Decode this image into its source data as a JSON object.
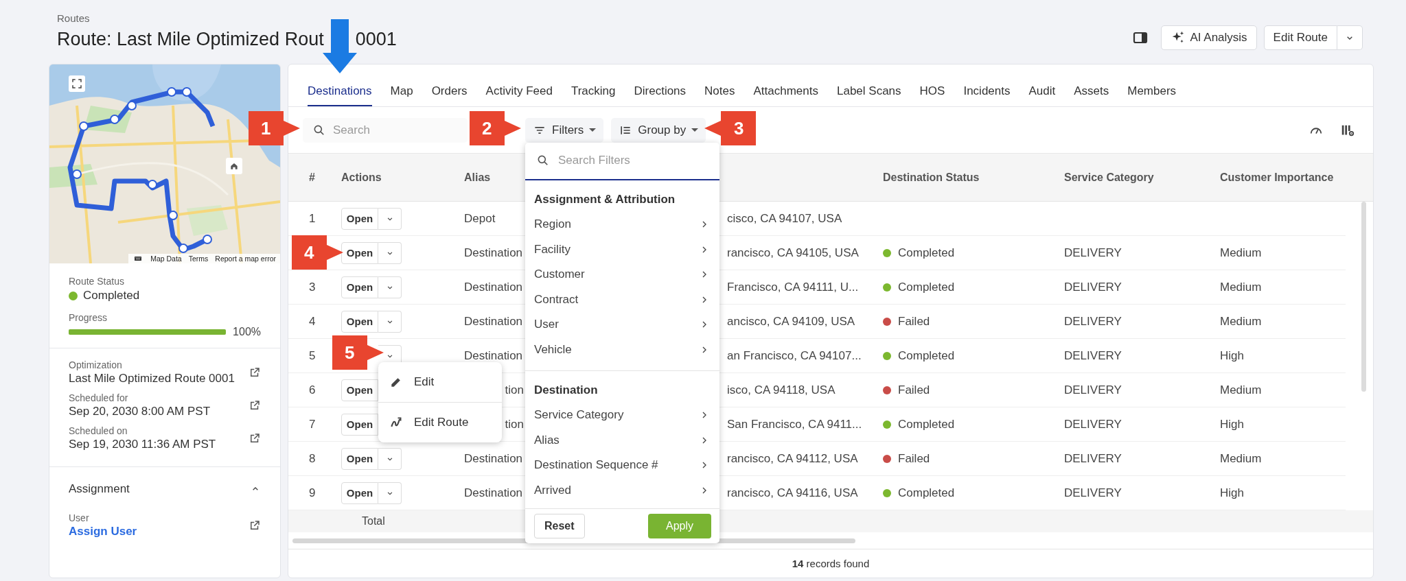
{
  "breadcrumb": "Routes",
  "title_parts": [
    "Route: Last Mile Optimized Rout",
    "0001"
  ],
  "header_actions": {
    "ai_button": "AI Analysis",
    "edit_button": "Edit Route"
  },
  "sidebar": {
    "map": {
      "kind": "picture",
      "attribution": [
        "Map Data",
        "Terms",
        "Report a map error"
      ]
    },
    "route_status": {
      "label": "Route Status",
      "value": "Completed",
      "color": "#7cb82f"
    },
    "progress": {
      "label": "Progress",
      "level": 1,
      "reading": "100%"
    },
    "details": [
      {
        "label": "Optimization",
        "value": "Last Mile Optimized Route 0001"
      },
      {
        "label": "Scheduled for",
        "value": "Sep 20, 2030 8:00 AM PST"
      },
      {
        "label": "Scheduled on",
        "value": "Sep 19, 2030 11:36 AM PST"
      }
    ],
    "assignment": {
      "title": "Assignment",
      "expanded": true,
      "fields": [
        {
          "label": "User",
          "value": "Assign User"
        }
      ]
    }
  },
  "tabs": [
    {
      "label": "Destinations",
      "selected": true
    },
    {
      "label": "Map",
      "selected": false
    },
    {
      "label": "Orders",
      "selected": false
    },
    {
      "label": "Activity Feed",
      "selected": false
    },
    {
      "label": "Tracking",
      "selected": false
    },
    {
      "label": "Directions",
      "selected": false
    },
    {
      "label": "Notes",
      "selected": false
    },
    {
      "label": "Attachments",
      "selected": false
    },
    {
      "label": "Label Scans",
      "selected": false
    },
    {
      "label": "HOS",
      "selected": false
    },
    {
      "label": "Incidents",
      "selected": false
    },
    {
      "label": "Audit",
      "selected": false
    },
    {
      "label": "Assets",
      "selected": false
    },
    {
      "label": "Members",
      "selected": false
    }
  ],
  "toolbar": {
    "search_placeholder": "Search",
    "filters": "Filters",
    "group_by": "Group by"
  },
  "table": {
    "columns": [
      "#",
      "Actions",
      "Alias",
      "Destination Status",
      "Service Category",
      "Customer Importance"
    ],
    "rows": [
      {
        "number": "1",
        "action": "Open",
        "alias": "Depot",
        "address": "cisco, CA 94107, USA"
      },
      {
        "action": "Open",
        "alias": "Destination",
        "address": "rancisco, CA 94105, USA",
        "status": "Completed",
        "color": "#7cb82f",
        "category": "DELIVERY",
        "importance": "Medium"
      },
      {
        "number": "3",
        "action": "Open",
        "alias": "Destination",
        "address": "Francisco, CA 94111, U...",
        "status": "Completed",
        "color": "#7cb82f",
        "category": "DELIVERY",
        "importance": "Medium"
      },
      {
        "number": "4",
        "action": "Open",
        "alias": "Destination",
        "address": "ancisco, CA 94109, USA",
        "status": "Failed",
        "color": "#c94c48",
        "category": "DELIVERY",
        "importance": "Medium"
      },
      {
        "number": "5",
        "alias": "Destination",
        "address": "an Francisco, CA 94107...",
        "status": "Completed",
        "color": "#7cb82f",
        "category": "DELIVERY",
        "importance": "High"
      },
      {
        "number": "6",
        "action": "Open",
        "no_dropdown": true,
        "alias": "tion",
        "address": "isco, CA 94118, USA",
        "status": "Failed",
        "color": "#c94c48",
        "category": "DELIVERY",
        "importance": "Medium"
      },
      {
        "number": "7",
        "action": "Open",
        "no_dropdown": true,
        "alias": "tion",
        "address": "San Francisco, CA 9411...",
        "status": "Completed",
        "color": "#7cb82f",
        "category": "DELIVERY",
        "importance": "High"
      },
      {
        "number": "8",
        "action": "Open",
        "alias": "Destination",
        "address": "rancisco, CA 94112, USA",
        "status": "Failed",
        "color": "#c94c48",
        "category": "DELIVERY",
        "importance": "Medium"
      },
      {
        "number": "9",
        "action": "Open",
        "alias": "Destination",
        "address": "rancisco, CA 94116, USA",
        "status": "Completed",
        "color": "#7cb82f",
        "category": "DELIVERY",
        "importance": "High"
      }
    ],
    "total_label": "Total"
  },
  "footer": "**14** records found",
  "filter_menu": {
    "search_placeholder": "Search Filters",
    "sections": [
      {
        "title": "Assignment & Attribution",
        "items": [
          "Region",
          "Facility",
          "Customer",
          "Contract",
          "User",
          "Vehicle"
        ]
      },
      {
        "title": "Destination",
        "items": [
          "Service Category",
          "Alias",
          "Destination Sequence #",
          "Arrived"
        ]
      }
    ],
    "reset": "Reset",
    "apply": "Apply"
  },
  "row_menu": {
    "items": [
      {
        "label": "Edit",
        "kind": "edit"
      },
      {
        "label": "Edit Route",
        "kind": "route"
      }
    ]
  },
  "callouts": [
    {
      "number": "1",
      "kind": "right"
    },
    {
      "number": "2",
      "kind": "right"
    },
    {
      "number": "3",
      "kind": "left"
    },
    {
      "number": "4",
      "kind": "right"
    },
    {
      "number": "5",
      "kind": "right"
    }
  ]
}
